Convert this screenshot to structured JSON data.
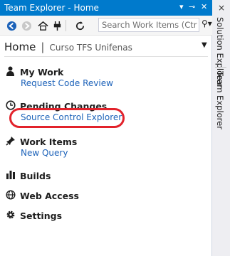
{
  "title_bar": {
    "title": "Team Explorer - Home",
    "dropdown_icon": "chevron-down-icon",
    "pin_icon": "pin-icon",
    "close_icon": "close-icon"
  },
  "toolbar": {
    "icons": [
      "back-arrow-icon",
      "forward-arrow-icon",
      "home-icon",
      "connect-plug-icon",
      "refresh-icon"
    ],
    "search_placeholder": "Search Work Items (Ctr",
    "search_icon": "search-icon"
  },
  "header": {
    "home_label": "Home",
    "separator": "|",
    "project": "Curso TFS Unifenas"
  },
  "sections": {
    "my_work": {
      "title": "My Work",
      "link": "Request Code Review"
    },
    "pending_changes": {
      "title": "Pending Changes",
      "link": "Source Control Explorer"
    },
    "work_items": {
      "title": "Work Items",
      "link": "New Query"
    },
    "builds": {
      "title": "Builds"
    },
    "web_access": {
      "title": "Web Access"
    },
    "settings": {
      "title": "Settings"
    }
  },
  "side_tabs": {
    "close_label": "×",
    "tab1": "Solution Explorer",
    "tab2": "Team Explorer"
  },
  "colors": {
    "accent": "#007acc",
    "link": "#1c62b9",
    "highlight": "#e2222b"
  }
}
